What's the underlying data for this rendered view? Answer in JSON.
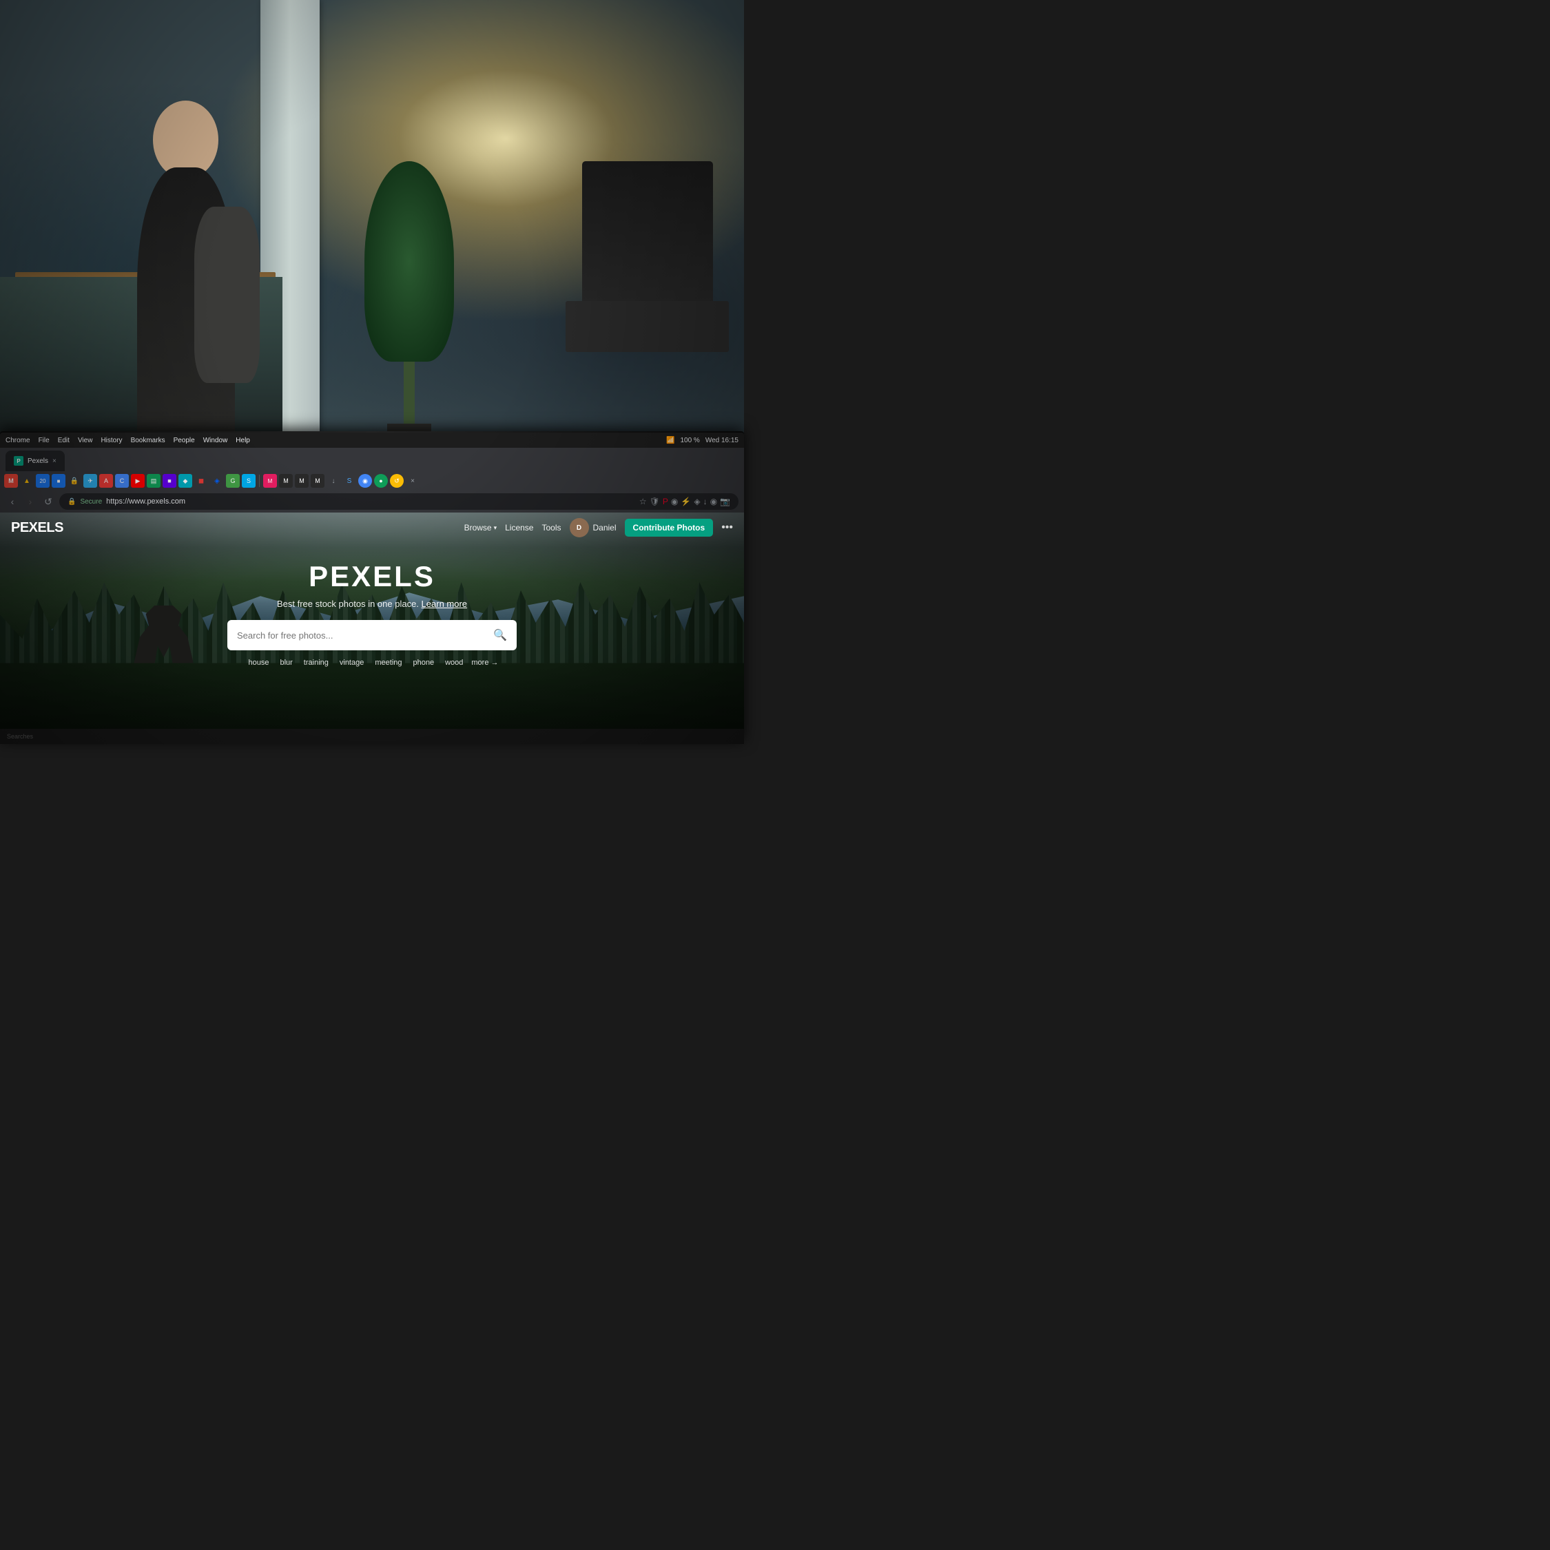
{
  "background": {
    "alt": "Office environment with blurred background"
  },
  "system_menubar": {
    "app_name": "Chrome",
    "menus": [
      "File",
      "Edit",
      "View",
      "History",
      "Bookmarks",
      "People",
      "Window",
      "Help"
    ],
    "time": "Wed 16:15",
    "battery_pct": "100 %"
  },
  "browser": {
    "tab": {
      "label": "Pexels",
      "favicon_letter": "P"
    },
    "url": {
      "secure_label": "Secure",
      "address": "https://www.pexels.com"
    },
    "nav": {
      "back": "‹",
      "refresh": "↺"
    }
  },
  "pexels": {
    "nav": {
      "logo": "PEXELS",
      "browse_label": "Browse",
      "license_label": "License",
      "tools_label": "Tools",
      "user_name": "Daniel",
      "contribute_label": "Contribute Photos",
      "more_icon": "•••"
    },
    "hero": {
      "title": "PEXELS",
      "tagline": "Best free stock photos in one place.",
      "tagline_link": "Learn more",
      "search_placeholder": "Search for free photos...",
      "tags": [
        "house",
        "blur",
        "training",
        "vintage",
        "meeting",
        "phone",
        "wood",
        "more →"
      ]
    }
  },
  "statusbar": {
    "text": "Searches"
  }
}
